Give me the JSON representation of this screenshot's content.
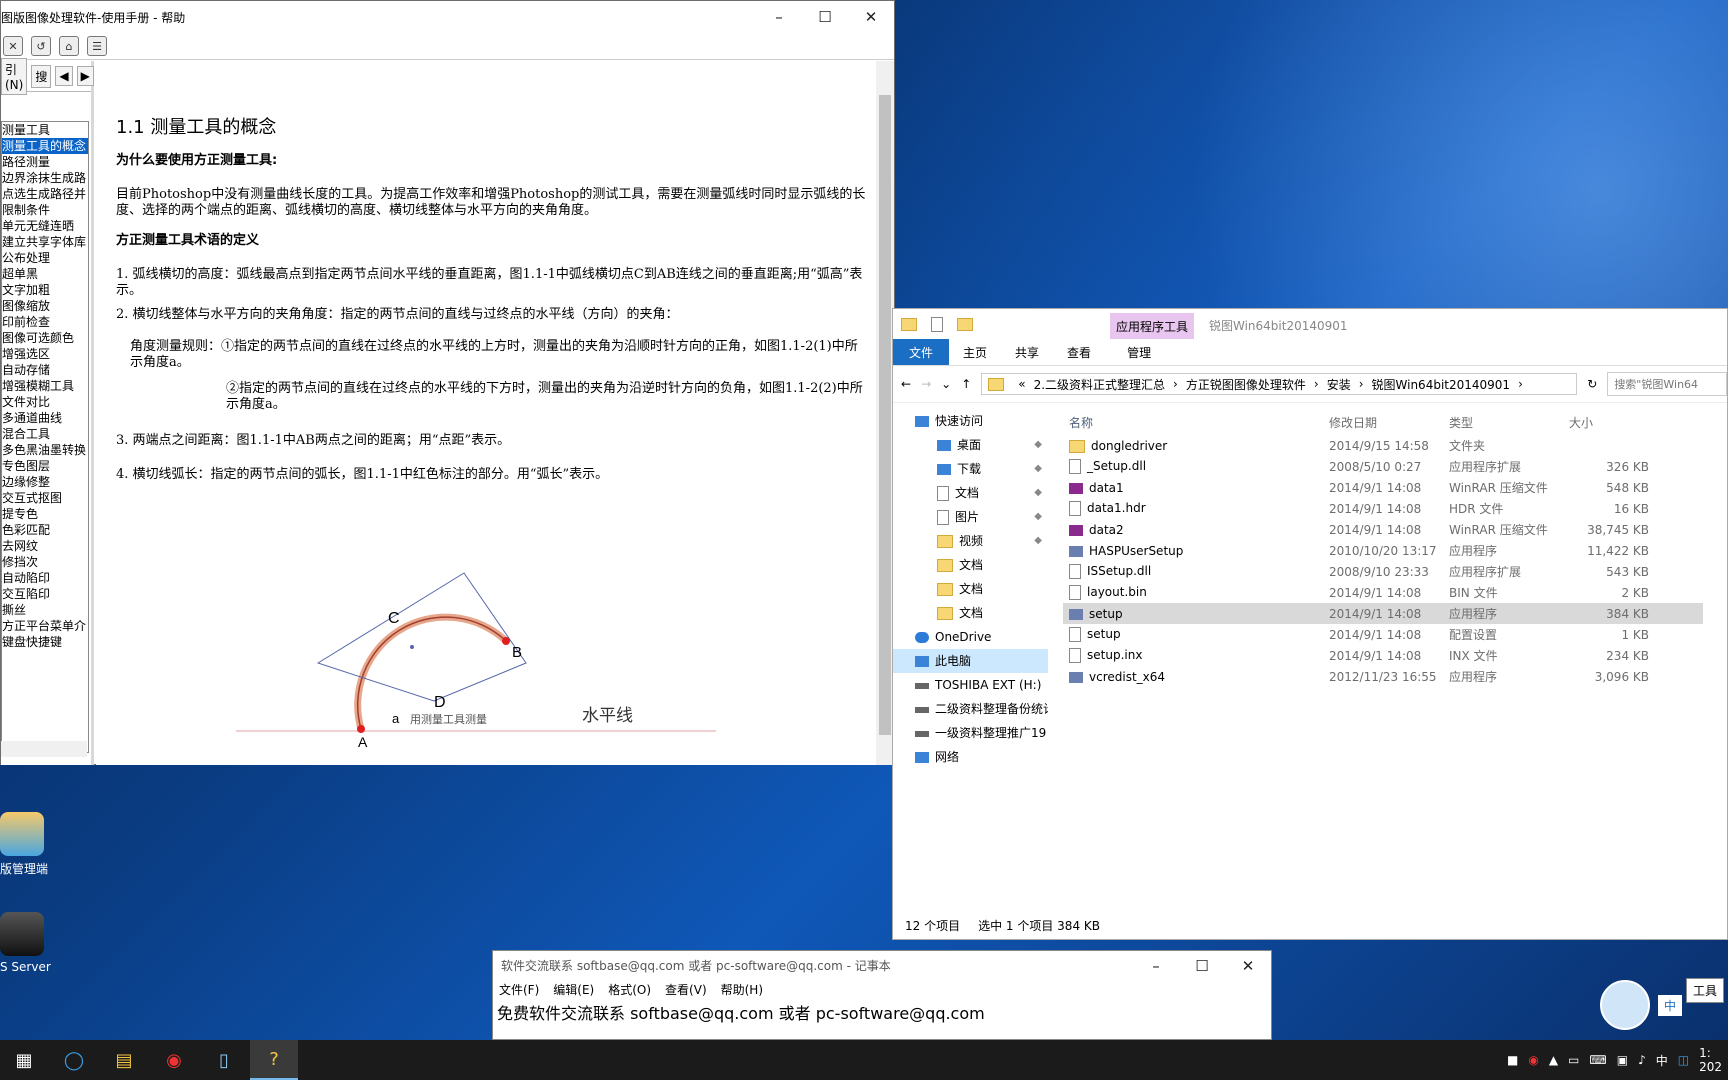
{
  "help": {
    "title": "图版图像处理软件-使用手册 - 帮助",
    "tabs": [
      "引(N)",
      "搜",
      "◀",
      "▶"
    ],
    "toc": [
      "测量工具",
      "测量工具的概念",
      "路径测量",
      "边界涂抹生成路",
      "点选生成路径并",
      "限制条件",
      "单元无缝连晒",
      "建立共享字体库",
      "公布处理",
      "超单黑",
      "文字加粗",
      "图像缩放",
      "印前检查",
      "图像可选颜色",
      "增强选区",
      "自动存储",
      "增强模糊工具",
      "文件对比",
      "多通道曲线",
      "混合工具",
      "多色黑油墨转换",
      "专色图层",
      "边缘修整",
      "交互式抠图",
      "提专色",
      "色彩匹配",
      "去网纹",
      "修挡次",
      "自动陷印",
      "交互陷印",
      "撕丝",
      "方正平台菜单介",
      "键盘快捷键"
    ],
    "heading": "1.1 测量工具的概念",
    "why_title": "为什么要使用方正测量工具:",
    "why_body": "目前Photoshop中没有测量曲线长度的工具。为提高工作效率和增强Photoshop的测试工具，需要在测量弧线时同时显示弧线的长度、选择的两个端点的距离、弧线横切的高度、横切线整体与水平方向的夹角角度。",
    "term_title": "方正测量工具术语的定义",
    "item1": "1. 弧线横切的高度：弧线最高点到指定两节点间水平线的垂直距离，图1.1-1中弧线横切点C到AB连线之间的垂直距离;用“弧高”表示。",
    "item2": "2. 横切线整体与水平方向的夹角角度：指定的两节点间的直线与过终点的水平线（方向）的夹角：",
    "rule1": "角度测量规则：①指定的两节点间的直线在过终点的水平线的上方时，测量出的夹角为沿顺时针方向的正角，如图1.1-2(1)中所示角度a。",
    "rule2": "②指定的两节点间的直线在过终点的水平线的下方时，测量出的夹角为沿逆时针方向的负角，如图1.1-2(2)中所示角度a。",
    "item3": "3. 两端点之间距离：图1.1-1中AB两点之间的距离；用“点距”表示。",
    "item4": "4. 横切线弧长：指定的两节点间的弧长，图1.1-1中红色标注的部分。用“弧长”表示。",
    "fig": {
      "C": "C",
      "B": "B",
      "D": "D",
      "A": "A",
      "a": "a",
      "caption": "用测量工具测量",
      "hline": "水平线"
    }
  },
  "explorer": {
    "app_tools": "应用程序工具",
    "title": "锐图Win64bit20140901",
    "ribbon": [
      "文件",
      "主页",
      "共享",
      "查看",
      "管理"
    ],
    "address": [
      "«",
      "2.二级资料正式整理汇总",
      "›",
      "方正锐图图像处理软件",
      "›",
      "安装",
      "›",
      "锐图Win64bit20140901",
      "›"
    ],
    "search_placeholder": "搜索\"锐图Win64",
    "nav": [
      {
        "label": "快速访问",
        "icon": "star-icon",
        "sub": false
      },
      {
        "label": "桌面",
        "icon": "desktop-icon",
        "sub": true,
        "pin": true
      },
      {
        "label": "下载",
        "icon": "download-icon",
        "sub": true,
        "pin": true
      },
      {
        "label": "文档",
        "icon": "document-icon",
        "sub": true,
        "pin": true
      },
      {
        "label": "图片",
        "icon": "picture-icon",
        "sub": true,
        "pin": true
      },
      {
        "label": "视频",
        "icon": "folder-icon",
        "sub": true,
        "pin": true
      },
      {
        "label": "文档",
        "icon": "folder-icon",
        "sub": true
      },
      {
        "label": "文档",
        "icon": "folder-icon",
        "sub": true
      },
      {
        "label": "文档",
        "icon": "folder-icon",
        "sub": true
      },
      {
        "label": "OneDrive",
        "icon": "cloud-icon",
        "sub": false
      },
      {
        "label": "此电脑",
        "icon": "computer-icon",
        "sub": false,
        "selected": true
      },
      {
        "label": "TOSHIBA EXT (H:)",
        "icon": "drive-icon",
        "sub": false
      },
      {
        "label": "二级资料整理备份统计",
        "icon": "drive-icon",
        "sub": false
      },
      {
        "label": "一级资料整理推广19",
        "icon": "drive-icon",
        "sub": false
      },
      {
        "label": "网络",
        "icon": "network-icon",
        "sub": false
      }
    ],
    "columns": [
      "名称",
      "修改日期",
      "类型",
      "大小"
    ],
    "files": [
      {
        "name": "dongledriver",
        "date": "2014/9/15 14:58",
        "type": "文件夹",
        "size": "",
        "icon": "folder"
      },
      {
        "name": "_Setup.dll",
        "date": "2008/5/10 0:27",
        "type": "应用程序扩展",
        "size": "326 KB",
        "icon": "file"
      },
      {
        "name": "data1",
        "date": "2014/9/1 14:08",
        "type": "WinRAR 压缩文件",
        "size": "548 KB",
        "icon": "rar"
      },
      {
        "name": "data1.hdr",
        "date": "2014/9/1 14:08",
        "type": "HDR 文件",
        "size": "16 KB",
        "icon": "file"
      },
      {
        "name": "data2",
        "date": "2014/9/1 14:08",
        "type": "WinRAR 压缩文件",
        "size": "38,745 KB",
        "icon": "rar"
      },
      {
        "name": "HASPUserSetup",
        "date": "2010/10/20 13:17",
        "type": "应用程序",
        "size": "11,422 KB",
        "icon": "app"
      },
      {
        "name": "ISSetup.dll",
        "date": "2008/9/10 23:33",
        "type": "应用程序扩展",
        "size": "543 KB",
        "icon": "file"
      },
      {
        "name": "layout.bin",
        "date": "2014/9/1 14:08",
        "type": "BIN 文件",
        "size": "2 KB",
        "icon": "file"
      },
      {
        "name": "setup",
        "date": "2014/9/1 14:08",
        "type": "应用程序",
        "size": "384 KB",
        "icon": "app",
        "selected": true
      },
      {
        "name": "setup",
        "date": "2014/9/1 14:08",
        "type": "配置设置",
        "size": "1 KB",
        "icon": "file"
      },
      {
        "name": "setup.inx",
        "date": "2014/9/1 14:08",
        "type": "INX 文件",
        "size": "234 KB",
        "icon": "file"
      },
      {
        "name": "vcredist_x64",
        "date": "2012/11/23 16:55",
        "type": "应用程序",
        "size": "3,096 KB",
        "icon": "app"
      }
    ],
    "status_count": "12 个项目",
    "status_selected": "选中 1 个项目  384 KB"
  },
  "notepad": {
    "title": "软件交流联系 softbase@qq.com 或者 pc-software@qq.com - 记事本",
    "menu": [
      "文件(F)",
      "编辑(E)",
      "格式(O)",
      "查看(V)",
      "帮助(H)"
    ],
    "text": "免费软件交流联系 softbase@qq.com 或者 pc-software@qq.com"
  },
  "desktop": {
    "icon1": "版管理端",
    "icon2": "S Server"
  },
  "tray": {
    "ime": "中",
    "tooltip": "工具",
    "clock_time": "1:",
    "clock_date": "202"
  }
}
